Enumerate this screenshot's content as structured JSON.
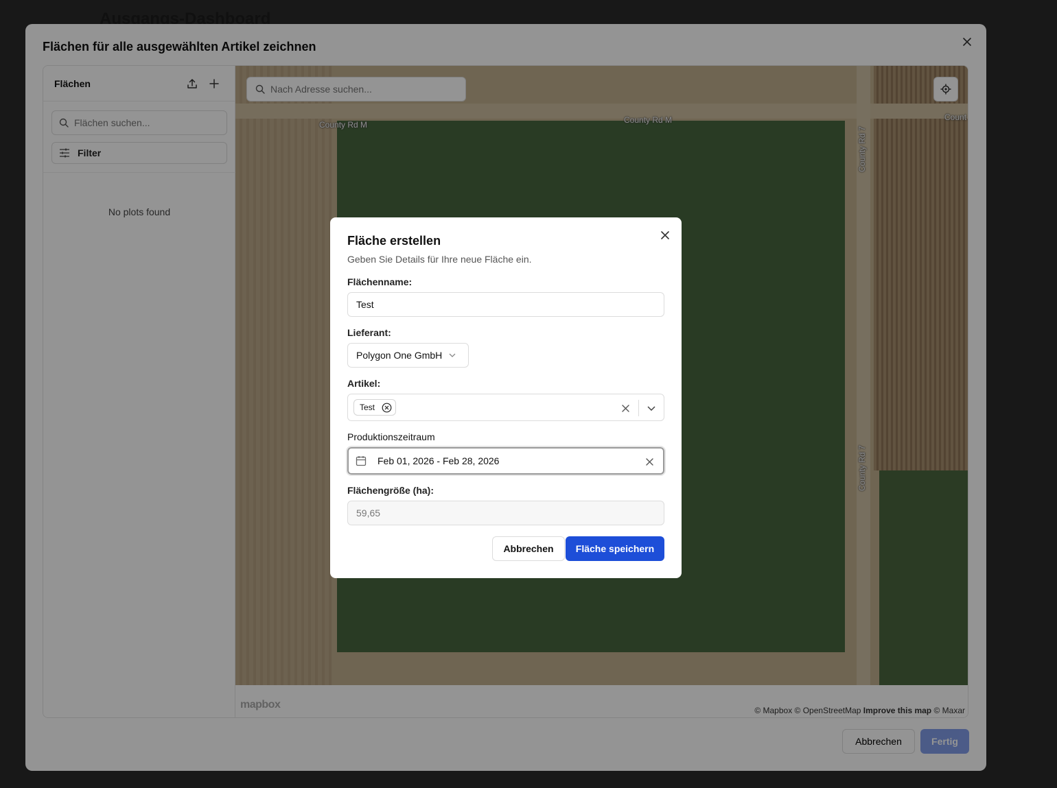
{
  "background": {
    "page_title": "Ausgangs-Dashboard"
  },
  "outer_dialog": {
    "title": "Flächen für alle ausgewählten Artikel zeichnen",
    "cancel_label": "Abbrechen",
    "done_label": "Fertig"
  },
  "sidebar": {
    "title": "Flächen",
    "search_placeholder": "Flächen suchen...",
    "filter_label": "Filter",
    "empty_text": "No plots found"
  },
  "map": {
    "search_placeholder": "Nach Adresse suchen...",
    "labels": {
      "road_top_left": "County Rd M",
      "road_top_center": "County Rd M",
      "road_top_right": "Count",
      "road_vertical_upper": "County Rd 7",
      "road_vertical_lower": "County Rd 7"
    },
    "logo_text": "mapbox",
    "attribution": {
      "mapbox": "© Mapbox",
      "osm": "© OpenStreetMap",
      "improve": "Improve this map",
      "maxar": "© Maxar"
    }
  },
  "create_dialog": {
    "title": "Fläche erstellen",
    "description": "Geben Sie Details für Ihre neue Fläche ein.",
    "name_label": "Flächenname:",
    "name_value": "Test",
    "supplier_label": "Lieferant:",
    "supplier_value": "Polygon One GmbH",
    "article_label": "Artikel:",
    "article_chips": [
      "Test"
    ],
    "period_label": "Produktionszeitraum",
    "period_value": "Feb 01, 2026 - Feb 28, 2026",
    "area_label": "Flächengröße (ha):",
    "area_value": "59,65",
    "cancel_label": "Abbrechen",
    "save_label": "Fläche speichern"
  },
  "colors": {
    "primary": "#1d4ed8",
    "field_green": "#47663e",
    "soil": "#bfae8e"
  }
}
